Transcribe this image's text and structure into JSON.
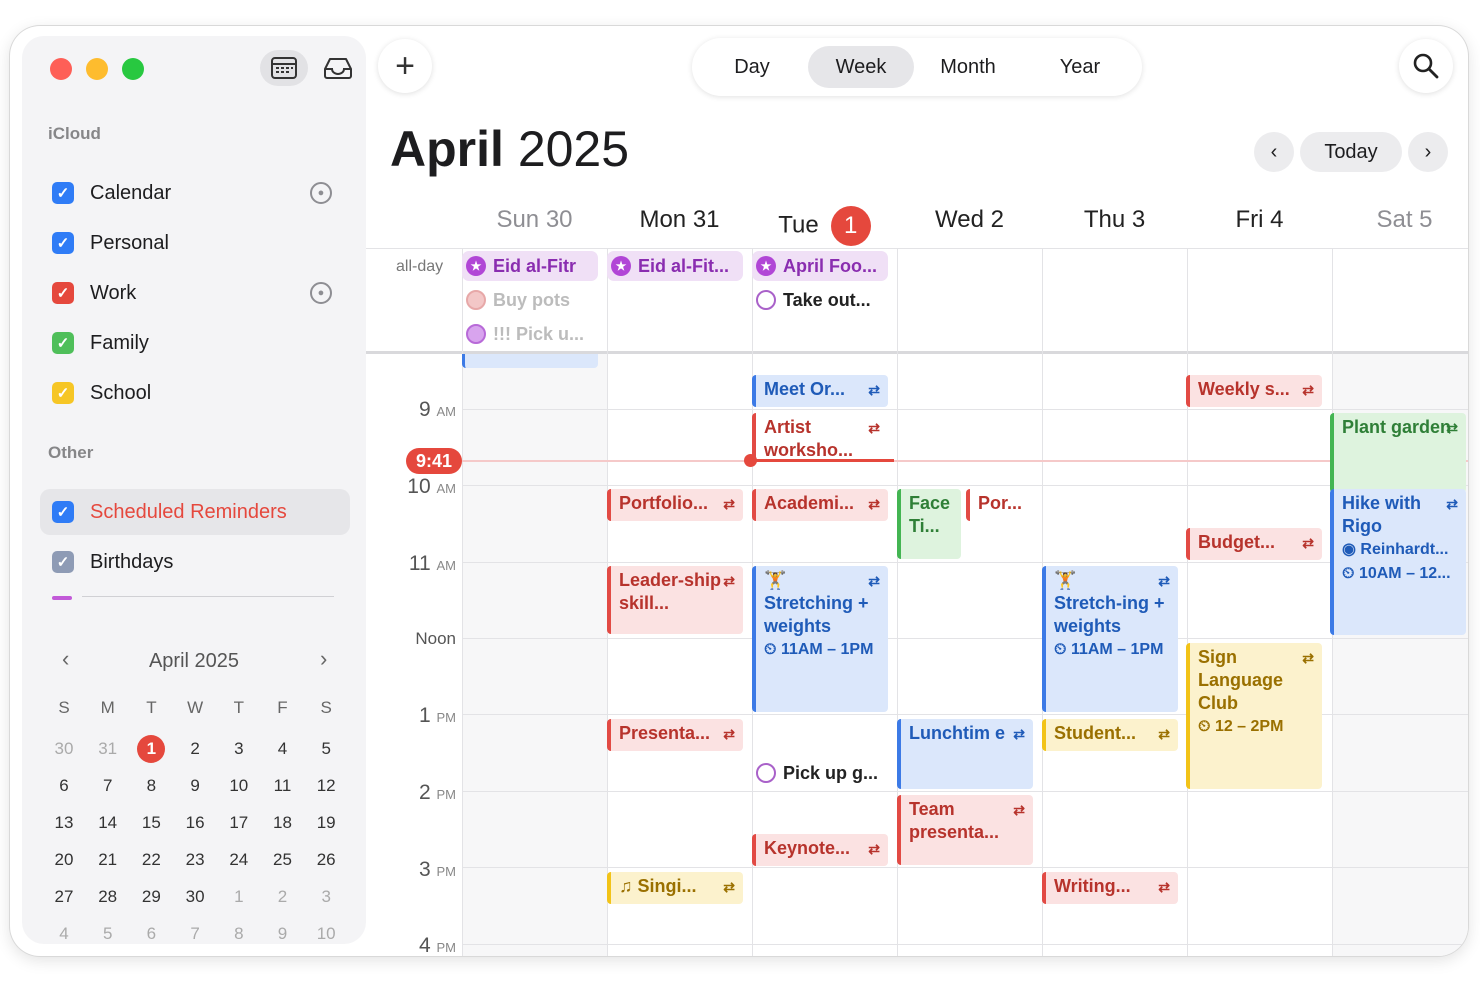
{
  "sidebar": {
    "icloud_header": "iCloud",
    "calendars": [
      {
        "name": "Calendar",
        "color": "#2f7cf6",
        "shared": true
      },
      {
        "name": "Personal",
        "color": "#2f7cf6",
        "shared": false
      },
      {
        "name": "Work",
        "color": "#e5483d",
        "shared": true
      },
      {
        "name": "Family",
        "color": "#4fbf5a",
        "shared": false
      },
      {
        "name": "School",
        "color": "#f6c625",
        "shared": false
      }
    ],
    "other_header": "Other",
    "other": [
      {
        "name": "Scheduled Reminders",
        "color": "#2f7cf6",
        "highlight_color": "#e5483d"
      },
      {
        "name": "Birthdays",
        "color": "#8e9bb5"
      }
    ]
  },
  "mini_calendar": {
    "title": "April 2025",
    "weekdays": [
      "S",
      "M",
      "T",
      "W",
      "T",
      "F",
      "S"
    ],
    "weeks": [
      [
        "30",
        "31",
        "1",
        "2",
        "3",
        "4",
        "5"
      ],
      [
        "6",
        "7",
        "8",
        "9",
        "10",
        "11",
        "12"
      ],
      [
        "13",
        "14",
        "15",
        "16",
        "17",
        "18",
        "19"
      ],
      [
        "20",
        "21",
        "22",
        "23",
        "24",
        "25",
        "26"
      ],
      [
        "27",
        "28",
        "29",
        "30",
        "1",
        "2",
        "3"
      ],
      [
        "4",
        "5",
        "6",
        "7",
        "8",
        "9",
        "10"
      ]
    ],
    "today": "1"
  },
  "toolbar": {
    "add_label": "+",
    "views": [
      "Day",
      "Week",
      "Month",
      "Year"
    ],
    "active_view": "Week",
    "today_label": "Today"
  },
  "header": {
    "month": "April",
    "year": "2025"
  },
  "days": [
    {
      "label": "Sun 30"
    },
    {
      "label": "Mon 31"
    },
    {
      "label": "Tue",
      "badge": "1"
    },
    {
      "label": "Wed 2"
    },
    {
      "label": "Thu 3"
    },
    {
      "label": "Fri 4"
    },
    {
      "label": "Sat 5"
    }
  ],
  "allday_label": "all-day",
  "allday": {
    "eid1": "Eid al-Fitr",
    "buy": "Buy pots",
    "pick": "!!! Pick u...",
    "eid2": "Eid al-Fit...",
    "fools": "April Foo...",
    "takeout": "Take out..."
  },
  "times": {
    "t9": {
      "h": "9",
      "ap": "AM"
    },
    "t10": {
      "h": "10",
      "ap": "AM"
    },
    "t11": {
      "h": "11",
      "ap": "AM"
    },
    "noon": "Noon",
    "t1": {
      "h": "1",
      "ap": "PM"
    },
    "t2": {
      "h": "2",
      "ap": "PM"
    },
    "t3": {
      "h": "3",
      "ap": "PM"
    },
    "t4": {
      "h": "4",
      "ap": "PM"
    }
  },
  "now": "9:41",
  "events": {
    "meet": "Meet Or...",
    "artist": "Artist worksho...",
    "academi": "Academi...",
    "stretch_tue": "Stretching + weights",
    "stretch_tue_time": "11AM – 1PM",
    "pickup": "Pick up g...",
    "keynote": "Keynote...",
    "portfolio": "Portfolio...",
    "leadership": "Leader-ship skill...",
    "presenta": "Presenta...",
    "singi": "Singi...",
    "face": "Face Ti...",
    "por": "Por...",
    "lunch": "Lunchtim e",
    "team": "Team presenta...",
    "stretch_thu": "Stretch-ing + weights",
    "stretch_thu_time": "11AM – 1PM",
    "student": "Student...",
    "writing": "Writing...",
    "weekly": "Weekly s...",
    "budget": "Budget...",
    "sign": "Sign Language Club",
    "sign_time": "12 – 2PM",
    "plant": "Plant garden",
    "hike": "Hike with Rigo",
    "hike_loc": "Reinhardt...",
    "hike_time": "10AM – 12..."
  }
}
